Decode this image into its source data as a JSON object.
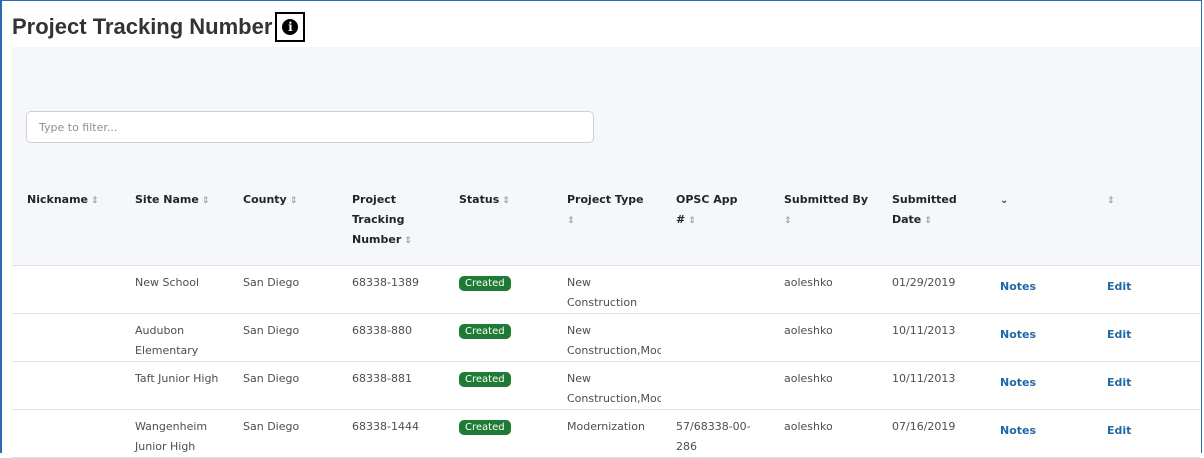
{
  "page": {
    "title": "Project Tracking Number"
  },
  "filter": {
    "placeholder": "Type to filter..."
  },
  "table": {
    "columns": [
      {
        "label": "Nickname",
        "sortable": true
      },
      {
        "label": "Site Name",
        "sortable": true
      },
      {
        "label": "County",
        "sortable": true
      },
      {
        "label": "Project Tracking Number",
        "sortable": true
      },
      {
        "label": "Status",
        "sortable": true
      },
      {
        "label": "Project Type",
        "sortable": true
      },
      {
        "label": "OPSC App #",
        "sortable": true
      },
      {
        "label": "Submitted By",
        "sortable": true
      },
      {
        "label": "Submitted Date",
        "sortable": true
      },
      {
        "label": "",
        "sortable": false
      },
      {
        "label": "",
        "sortable": true
      }
    ],
    "rows": [
      {
        "nickname": "",
        "site_name": "New School",
        "county": "San Diego",
        "ptn": "68338-1389",
        "status": "Created",
        "project_type": "New Construction",
        "opsc_app": "",
        "submitted_by": "aoleshko",
        "submitted_date": "01/29/2019",
        "notes": "Notes",
        "edit": "Edit"
      },
      {
        "nickname": "",
        "site_name": "Audubon Elementary",
        "county": "San Diego",
        "ptn": "68338-880",
        "status": "Created",
        "project_type": "New Construction,Modernization",
        "opsc_app": "",
        "submitted_by": "aoleshko",
        "submitted_date": "10/11/2013",
        "notes": "Notes",
        "edit": "Edit"
      },
      {
        "nickname": "",
        "site_name": "Taft Junior High",
        "county": "San Diego",
        "ptn": "68338-881",
        "status": "Created",
        "project_type": "New Construction,Modernization",
        "opsc_app": "",
        "submitted_by": "aoleshko",
        "submitted_date": "10/11/2013",
        "notes": "Notes",
        "edit": "Edit"
      },
      {
        "nickname": "",
        "site_name": "Wangenheim Junior High",
        "county": "San Diego",
        "ptn": "68338-1444",
        "status": "Created",
        "project_type": "Modernization",
        "opsc_app": "57/68338-00-286",
        "submitted_by": "aoleshko",
        "submitted_date": "07/16/2019",
        "notes": "Notes",
        "edit": "Edit"
      }
    ]
  },
  "colors": {
    "accent": "#2b6cb0",
    "status_created": "#1e7b34",
    "link": "#2169a8"
  }
}
